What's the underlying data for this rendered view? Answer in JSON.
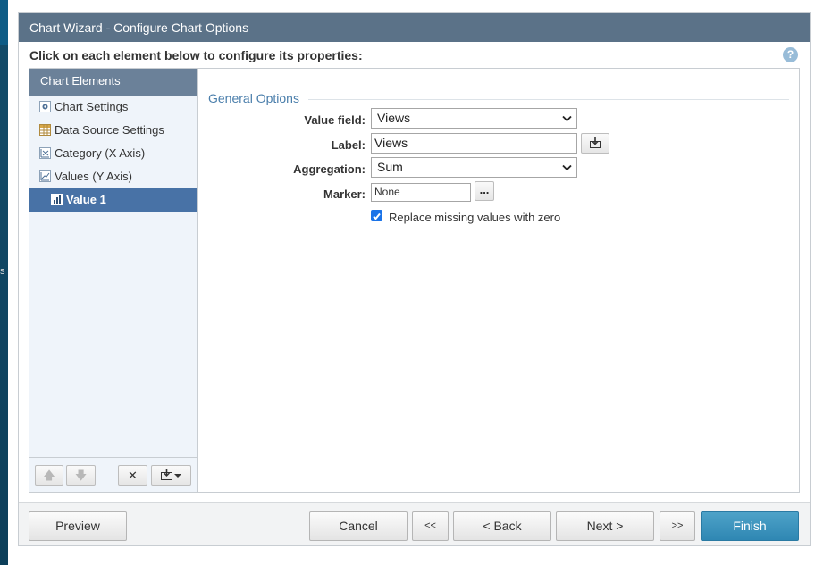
{
  "background": {
    "edge_text": "s"
  },
  "dialog": {
    "title": "Chart Wizard - Configure Chart Options",
    "instruction": "Click on each element below to configure its properties:",
    "help_icon": "?"
  },
  "sidebar": {
    "header": "Chart Elements",
    "items": [
      {
        "label": "Chart Settings",
        "icon": "gear-icon"
      },
      {
        "label": "Data Source Settings",
        "icon": "table-icon"
      },
      {
        "label": "Category (X Axis)",
        "icon": "x-axis-icon"
      },
      {
        "label": "Values (Y Axis)",
        "icon": "y-axis-icon"
      },
      {
        "label": "Value 1",
        "icon": "bar-chart-icon",
        "selected": true
      }
    ],
    "toolbar": {
      "move_up": "🡅",
      "move_down": "🡇",
      "delete": "✕"
    }
  },
  "form": {
    "section_title": "General Options",
    "value_field_label": "Value field:",
    "value_field_value": "Views",
    "label_label": "Label:",
    "label_value": "Views",
    "aggregation_label": "Aggregation:",
    "aggregation_value": "Sum",
    "marker_label": "Marker:",
    "marker_value": "None",
    "marker_button": "...",
    "replace_missing_label": "Replace missing values with zero",
    "replace_missing_checked": true
  },
  "footer": {
    "preview": "Preview",
    "cancel": "Cancel",
    "first": "<<",
    "back": "< Back",
    "next": "Next >",
    "last": ">>",
    "finish": "Finish"
  },
  "colors": {
    "titlebar": "#5b7288",
    "sidebar_header": "#6b8199",
    "selected_item": "#4872a6",
    "section_title": "#4a7eab",
    "finish_button": "#3590bd"
  }
}
